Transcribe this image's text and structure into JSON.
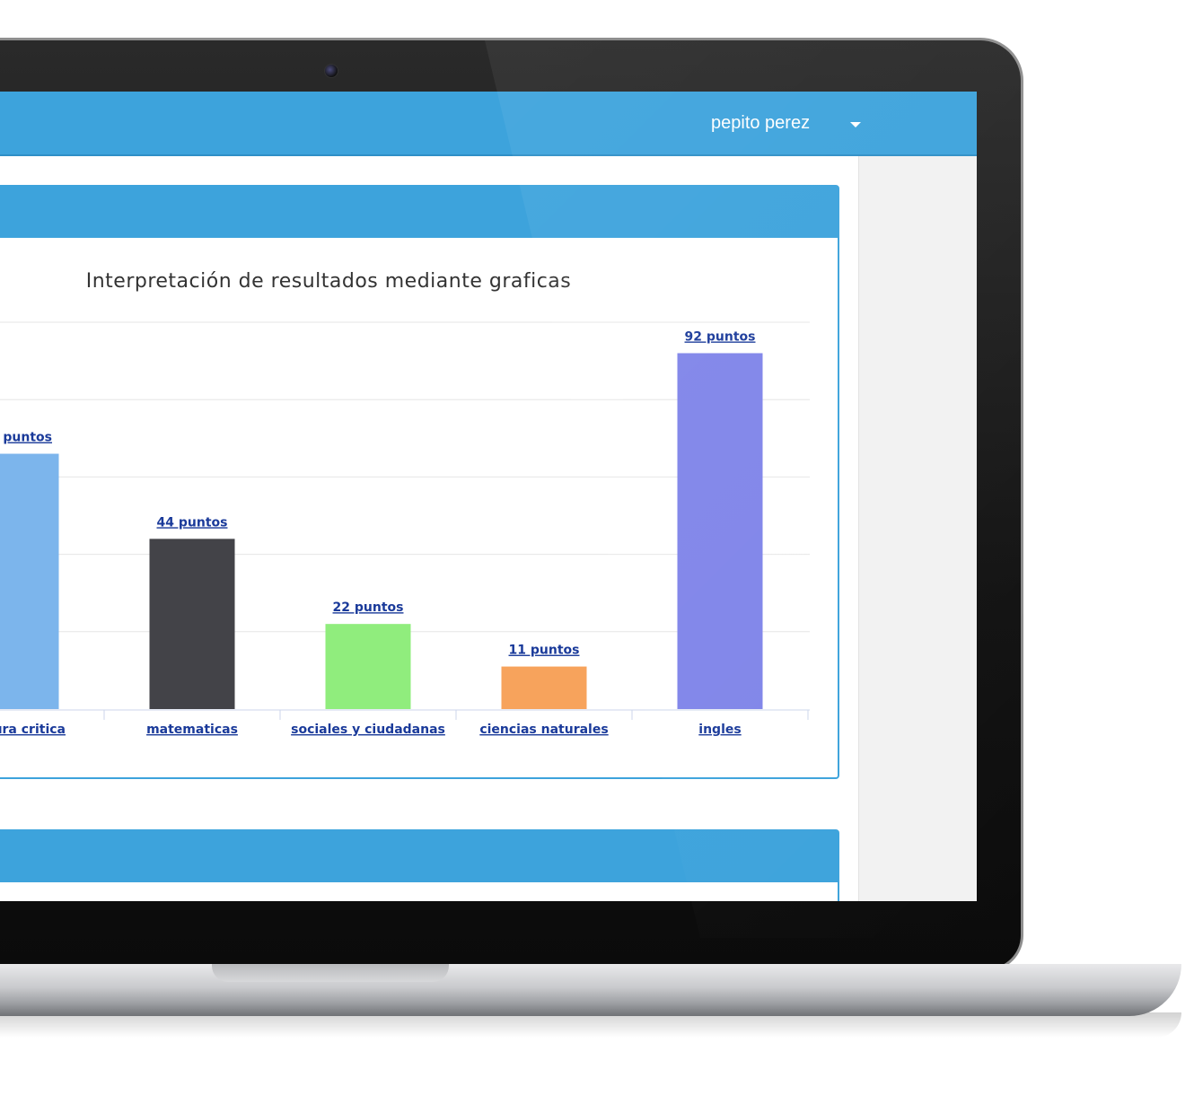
{
  "user": {
    "name": "pepito perez"
  },
  "icons": {
    "user_menu": "caret-down-icon",
    "camera": "webcam-icon"
  },
  "colors": {
    "navbar": "#3da3dc",
    "label": "#1a3a9a"
  },
  "chart_data": {
    "type": "bar",
    "title": "Interpretación de resultados mediante graficas",
    "categories": [
      "lectura critica",
      "matematicas",
      "sociales y ciudadanas",
      "ciencias naturales",
      "ingles"
    ],
    "visible_category_text": [
      "ura critica",
      "matematicas",
      "sociales y ciudadanas",
      "ciencias naturales",
      "ingles"
    ],
    "values": [
      66,
      44,
      22,
      11,
      92
    ],
    "value_labels": [
      "puntos",
      "44 puntos",
      "22 puntos",
      "11 puntos",
      "92 puntos"
    ],
    "bar_colors": [
      "#7cb5ec",
      "#434348",
      "#90ed7d",
      "#f7a35c",
      "#8085e9"
    ],
    "ylim": [
      0,
      100
    ],
    "grid": true,
    "xlabel": "",
    "ylabel": ""
  }
}
